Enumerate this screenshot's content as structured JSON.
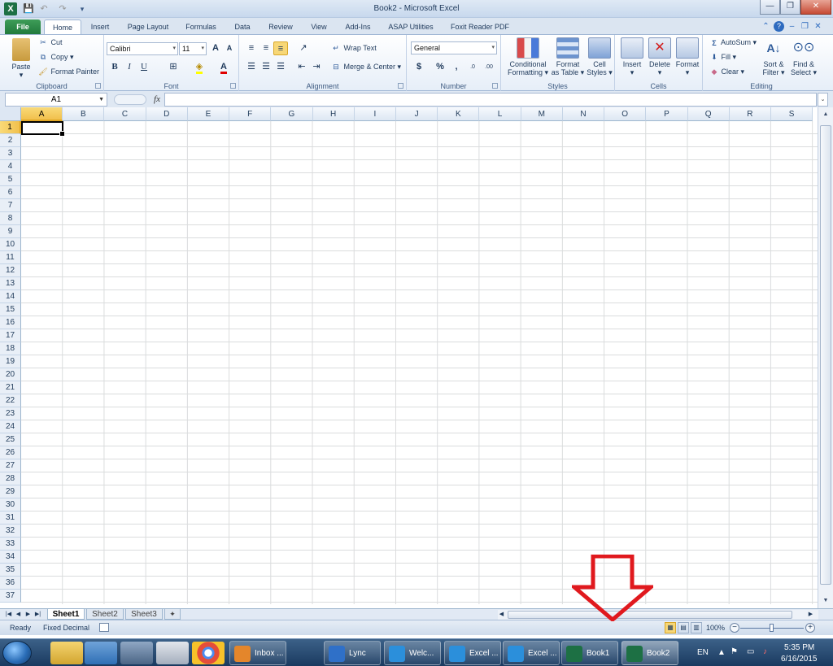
{
  "window": {
    "title": "Book2 - Microsoft Excel",
    "app_icon": "X"
  },
  "qat": {
    "save_icon": "💾",
    "undo_icon": "↶",
    "redo_icon": "↷",
    "customize_icon": "▾"
  },
  "winbtns": {
    "min": "—",
    "max": "❐",
    "close": "✕"
  },
  "tabs": [
    "File",
    "Home",
    "Insert",
    "Page Layout",
    "Formulas",
    "Data",
    "Review",
    "View",
    "Add-Ins",
    "ASAP Utilities",
    "Foxit Reader PDF"
  ],
  "ribbon": {
    "clipboard": {
      "title": "Clipboard",
      "paste": "Paste",
      "cut": "Cut",
      "copy": "Copy",
      "copy_dd": "▾",
      "format_painter": "Format Painter"
    },
    "font": {
      "title": "Font",
      "font_name": "Calibri",
      "font_size": "11",
      "grow": "A",
      "shrink": "A",
      "bold": "B",
      "italic": "I",
      "underline": "U",
      "font_color_letter": "A"
    },
    "alignment": {
      "title": "Alignment",
      "wrap_text": "Wrap Text",
      "merge_center": "Merge & Center"
    },
    "number": {
      "title": "Number",
      "format": "General",
      "currency": "$",
      "percent": "%",
      "comma": ",",
      "inc_dec": ".0",
      "dec_dec": ".00"
    },
    "styles": {
      "title": "Styles",
      "conditional": "Conditional",
      "conditional2": "Formatting",
      "format_table": "Format",
      "format_table2": "as Table",
      "cell_styles": "Cell",
      "cell_styles2": "Styles"
    },
    "cells": {
      "title": "Cells",
      "insert": "Insert",
      "delete": "Delete",
      "format": "Format"
    },
    "editing": {
      "title": "Editing",
      "autosum": "AutoSum",
      "fill": "Fill",
      "clear": "Clear",
      "sort": "Sort &",
      "sort2": "Filter",
      "find": "Find &",
      "find2": "Select"
    }
  },
  "formula_bar": {
    "name_box": "A1",
    "fx": "fx",
    "formula": ""
  },
  "columns": [
    "A",
    "B",
    "C",
    "D",
    "E",
    "F",
    "G",
    "H",
    "I",
    "J",
    "K",
    "L",
    "M",
    "N",
    "O",
    "P",
    "Q",
    "R",
    "S"
  ],
  "rows": [
    "1",
    "2",
    "3",
    "4",
    "5",
    "6",
    "7",
    "8",
    "9",
    "10",
    "11",
    "12",
    "13",
    "14",
    "15",
    "16",
    "17",
    "18",
    "19",
    "20",
    "21",
    "22",
    "23",
    "24",
    "25",
    "26",
    "27",
    "28",
    "29",
    "30",
    "31",
    "32",
    "33",
    "34",
    "35",
    "36",
    "37"
  ],
  "sheet_tabs": [
    "Sheet1",
    "Sheet2",
    "Sheet3"
  ],
  "status": {
    "ready": "Ready",
    "fixed_decimal": "Fixed Decimal",
    "zoom": "100%",
    "zoom_minus": "−",
    "zoom_plus": "+"
  },
  "taskbar": {
    "items": [
      {
        "label": "Inbox ...",
        "color": "#e4862b"
      },
      {
        "label": "Lync",
        "color": "#2f70c8"
      },
      {
        "label": "Welc...",
        "color": "#2b8fdb"
      },
      {
        "label": "Excel ...",
        "color": "#2b8fdb"
      },
      {
        "label": "Excel ...",
        "color": "#2b8fdb"
      },
      {
        "label": "Book1",
        "color": "#1d7044"
      },
      {
        "label": "Book2",
        "color": "#1d7044"
      }
    ],
    "lang": "EN",
    "time": "5:35 PM",
    "date": "6/16/2015"
  }
}
